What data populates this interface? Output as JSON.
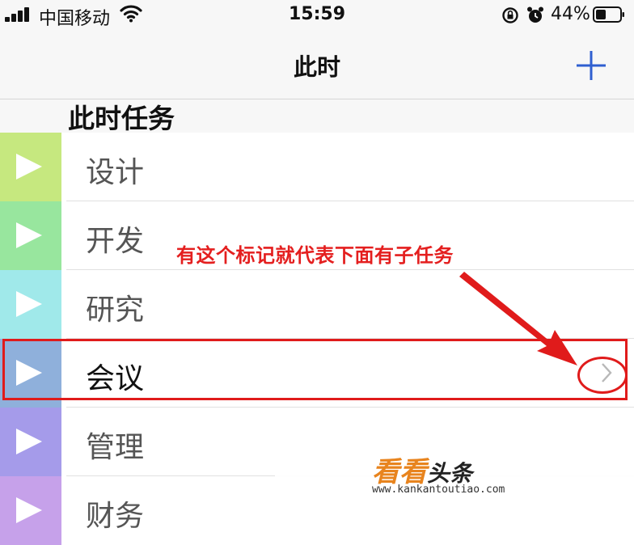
{
  "status_bar": {
    "carrier": "中国移动",
    "time": "15:59",
    "battery_percent": "44%",
    "battery_level": 0.44,
    "icons": [
      "signal-icon",
      "wifi-icon",
      "rotation-lock-icon",
      "alarm-icon",
      "battery-icon"
    ]
  },
  "nav": {
    "title": "此时",
    "add_icon": "plus-icon",
    "accent_color": "#2f5fd0"
  },
  "section_header": "此时任务",
  "tasks": [
    {
      "label": "设计",
      "color": "#c6e87f"
    },
    {
      "label": "开发",
      "color": "#98e69e"
    },
    {
      "label": "研究",
      "color": "#a0e9ea"
    },
    {
      "label": "会议",
      "color": "#8fb0db",
      "has_children": true
    },
    {
      "label": "管理",
      "color": "#a59bea"
    },
    {
      "label": "财务",
      "color": "#c6a1ea"
    }
  ],
  "annotation": {
    "text": "有这个标记就代表下面有子任务",
    "color": "#e01b1b"
  },
  "watermark": {
    "brand_colored": "看看",
    "brand_plain": "头条",
    "url": "www.kankantoutiao.com"
  }
}
